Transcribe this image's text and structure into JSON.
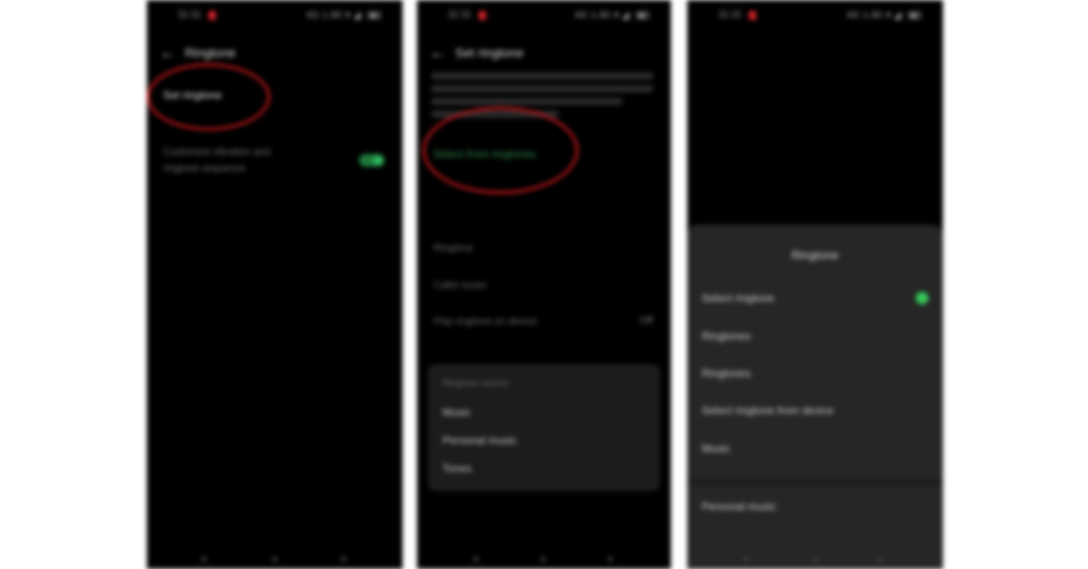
{
  "colors": {
    "screen_bg": "#000000",
    "sheet_bg": "#262626",
    "highlight": "#c2161c",
    "accent_green": "#34c759",
    "link_green": "#2e8b4a"
  },
  "icons": {
    "back": "←",
    "notification": "app-notification-icon",
    "battery": "battery-icon",
    "check": "check-circle-icon"
  },
  "phone1": {
    "status": {
      "time": "11:11",
      "right": "4G 1.6K ▾ ◢"
    },
    "title": "Ringtone",
    "item": "Set ringtone",
    "desc_line1": "Customize vibration and",
    "desc_line2": "ringtone sequence",
    "toggle_on": true
  },
  "phone2": {
    "status": {
      "time": "11:11",
      "right": "4G 1.6K ▾ ◢"
    },
    "title": "Set ringtone",
    "link": "Select from ringtones",
    "rows": [
      "Ringtone",
      "Caller tunes",
      "Play ringtone on device"
    ],
    "row3_value": "Off",
    "card": {
      "title": "Ringtone source",
      "items": [
        "Music",
        "Personal music",
        "Tones"
      ]
    }
  },
  "phone3": {
    "status": {
      "time": "11:11",
      "right": "4G 1.6K ▾ ◢"
    },
    "sheet_title": "Ringtone",
    "options": [
      "Select ringtone",
      "Ringtones",
      "Ringtones",
      "Select ringtone from device",
      "Music"
    ],
    "footer_option": "Personal music"
  }
}
